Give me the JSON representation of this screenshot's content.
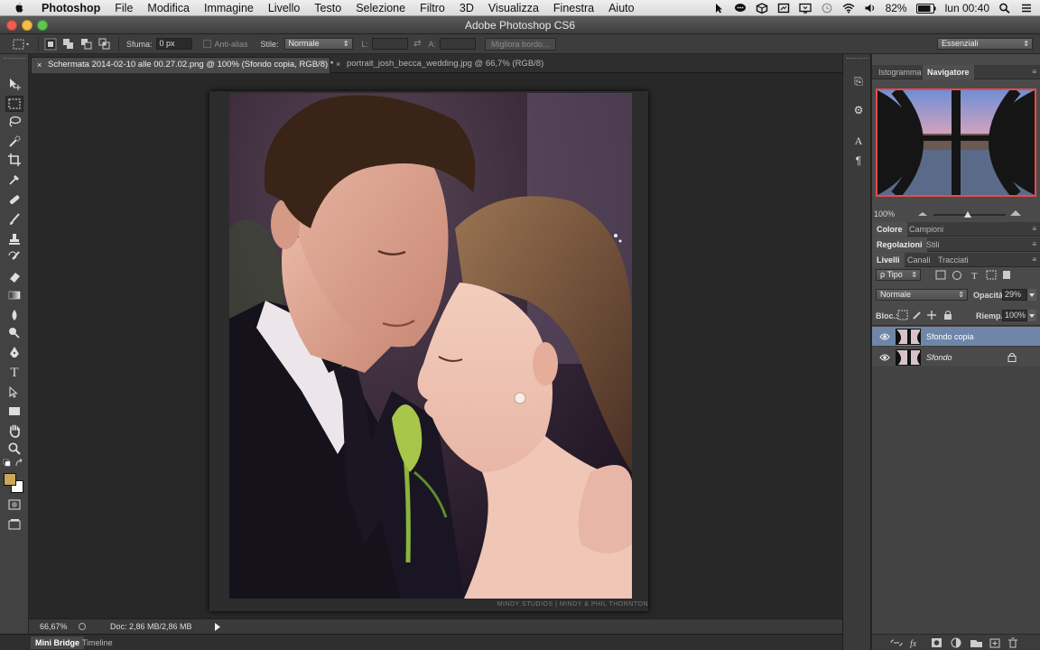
{
  "menubar": {
    "app_name": "Photoshop",
    "items": [
      "File",
      "Modifica",
      "Immagine",
      "Livello",
      "Testo",
      "Selezione",
      "Filtro",
      "3D",
      "Visualizza",
      "Finestra",
      "Aiuto"
    ],
    "battery": "82%",
    "clock": "lun 00:40"
  },
  "window": {
    "title": "Adobe Photoshop CS6"
  },
  "options": {
    "feather_label": "Sfuma:",
    "feather_value": "0 px",
    "antialias_label": "Anti-alias",
    "style_label": "Stile:",
    "style_value": "Normale",
    "width_label": "L:",
    "height_label": "A:",
    "refine_edge": "Migliora bordo...",
    "workspace": "Essenziali"
  },
  "tabs": {
    "doc1": "Schermata 2014-02-10 alle 00.27.02.png @ 100% (Sfondo copia, RGB/8) *",
    "doc2": "portrait_josh_becca_wedding.jpg @ 66,7% (RGB/8)"
  },
  "canvas": {
    "credit": "MINDY STUDIOS  |  MINDY & PHIL THORNTON"
  },
  "status": {
    "zoom": "66,67%",
    "doc_size": "Doc: 2,86 MB/2,86 MB"
  },
  "bottom_tabs": {
    "mini_bridge": "Mini Bridge",
    "timeline": "Timeline"
  },
  "panels": {
    "histogram_tab": "Istogramma",
    "navigator_tab": "Navigatore",
    "nav_zoom": "100%",
    "color_tab": "Colore",
    "swatches_tab": "Campioni",
    "adjustments_tab": "Regolazioni",
    "styles_tab": "Stili",
    "layers_tab": "Livelli",
    "channels_tab": "Canali",
    "paths_tab": "Tracciati",
    "filter_kind": "ρ Tipo",
    "blend_mode": "Normale",
    "opacity_label": "Opacità:",
    "opacity_value": "29%",
    "lock_label": "Bloc.:",
    "fill_label": "Riemp.:",
    "fill_value": "100%"
  },
  "layers": [
    {
      "name": "Sfondo copia",
      "selected": true
    },
    {
      "name": "Sfondo",
      "selected": false,
      "locked": true
    }
  ],
  "colors": {
    "foreground": "#c9a85a",
    "background": "#ffffff",
    "selection_highlight": "#6f86a8",
    "navigator_frame": "#e94a4a"
  }
}
